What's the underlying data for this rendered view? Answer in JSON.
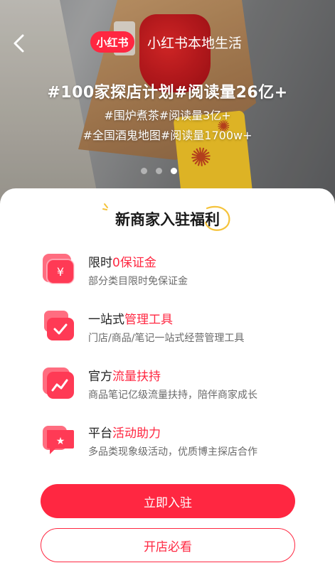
{
  "header": {
    "back_icon": "chevron-left-icon",
    "logo_text": "小红书",
    "title": "小红书本地生活"
  },
  "hero": {
    "headline": "#100家探店计划#阅读量26亿+",
    "subline1": "#围炉煮茶#阅读量3亿+",
    "subline2": "#全国酒鬼地图#阅读量1700w+",
    "carousel": {
      "count": 3,
      "active_index": 2
    }
  },
  "benefits": {
    "title": "新商家入驻福利",
    "items": [
      {
        "icon": "yen-icon",
        "title_prefix": "限时",
        "title_highlight": "0保证金",
        "desc": "部分类目限时免保证金"
      },
      {
        "icon": "manage-check-icon",
        "title_prefix": "一站式",
        "title_highlight": "管理工具",
        "desc": "门店/商品/笔记一站式经营管理工具"
      },
      {
        "icon": "trend-icon",
        "title_prefix": "官方",
        "title_highlight": "流量扶持",
        "desc": "商品笔记亿级流量扶持，陪伴商家成长"
      },
      {
        "icon": "star-flag-icon",
        "title_prefix": "平台",
        "title_highlight": "活动助力",
        "desc": "多品类现象级活动，优质博主探店合作"
      }
    ]
  },
  "actions": {
    "primary_label": "立即入驻",
    "secondary_label": "开店必看"
  },
  "colors": {
    "brand_red": "#ff2741",
    "accent_yellow": "#f5c33b"
  }
}
